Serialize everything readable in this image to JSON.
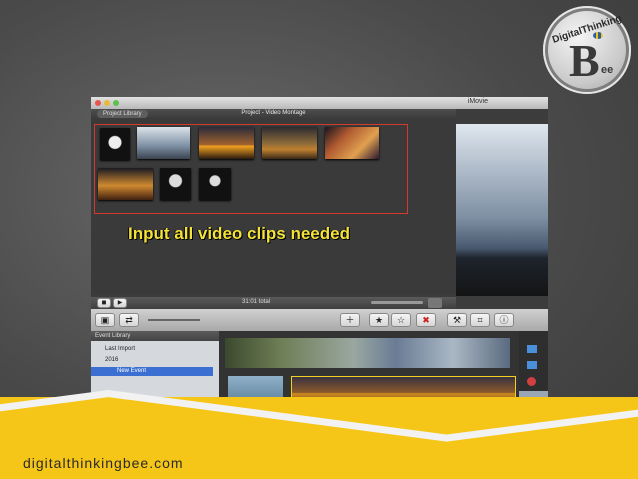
{
  "logo": {
    "line1": "DigitalThinking",
    "letter": "B",
    "suffix": "ee",
    "colors": {
      "ring": "#c9c9c9"
    }
  },
  "window": {
    "app_title": "iMovie",
    "project_library_label": "Project Library",
    "project_title": "Project - Video Montage",
    "caption": "Input all video clips needed",
    "total_label": "31:01 total",
    "accent_color": "#d23a2a",
    "caption_color": "#f3e23a"
  },
  "toolbar": {
    "buttons": [
      "video-camera-icon",
      "swap-icon",
      "add-icon",
      "favorite-star-icon",
      "unmark-star-icon",
      "reject-x-icon",
      "wrench-icon",
      "crop-icon",
      "info-icon"
    ]
  },
  "event_library": {
    "header": "Event Library",
    "items": [
      "Last Import",
      "2016",
      "New Event"
    ]
  },
  "footer": {
    "site": "digitalthinkingbee.com",
    "band_color": "#f5c518"
  }
}
